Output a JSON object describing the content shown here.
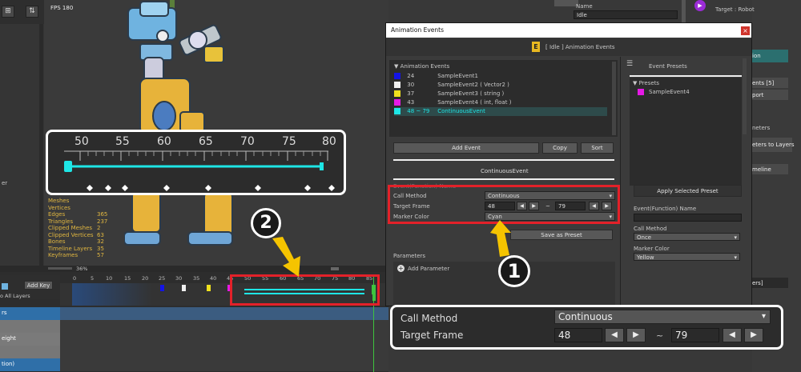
{
  "toolbar": {
    "fps": "FPS 180"
  },
  "inspector": {
    "name_label": "Name",
    "name_value": "Idle",
    "target_label": "Target : Robot"
  },
  "stats": [
    {
      "k": "Meshes",
      "v": ""
    },
    {
      "k": "Vertices",
      "v": ""
    },
    {
      "k": "Edges",
      "v": "365"
    },
    {
      "k": "Triangles",
      "v": "237"
    },
    {
      "k": "Clipped Meshes",
      "v": "2"
    },
    {
      "k": "Clipped Vertices",
      "v": "63"
    },
    {
      "k": "Bones",
      "v": "32"
    },
    {
      "k": "Timeline Layers",
      "v": "35"
    },
    {
      "k": "Keyframes",
      "v": "57"
    }
  ],
  "zoom_ruler": {
    "ticks": [
      "50",
      "55",
      "60",
      "65",
      "70",
      "75",
      "80"
    ]
  },
  "timeline": {
    "zoom_pct": "36%",
    "ruler": [
      "0",
      "5",
      "10",
      "15",
      "20",
      "25",
      "30",
      "35",
      "40",
      "45",
      "50",
      "55",
      "60",
      "65",
      "70",
      "75",
      "80",
      "85"
    ],
    "add_key": "Add Key",
    "all_layers": "o All Layers",
    "layer_labels": [
      "rs",
      "",
      "eight",
      "",
      "tion)"
    ]
  },
  "dialog": {
    "title": "Animation Events",
    "header": "[ Idle ] Animation Events",
    "events_header": "▼ Animation Events",
    "events": [
      {
        "frame": "24",
        "name": "SampleEvent1",
        "color": "#1414e6"
      },
      {
        "frame": "30",
        "name": "SampleEvent2  ( Vector2 )",
        "color": "#f0f0f0"
      },
      {
        "frame": "37",
        "name": "SampleEvent3  ( string )",
        "color": "#f0e11e"
      },
      {
        "frame": "43",
        "name": "SampleEvent4  ( int, float )",
        "color": "#e619e6"
      },
      {
        "frame": "48 ~ 79",
        "name": "ContinuousEvent",
        "color": "#1ee6e6"
      }
    ],
    "add_event": "Add Event",
    "copy": "Copy",
    "sort": "Sort",
    "selected_event": "ContinuousEvent",
    "hidden_row": "Event(Function) Name",
    "call_method_label": "Call Method",
    "call_method_value": "Continuous",
    "target_frame_label": "Target Frame",
    "frame_start": "48",
    "frame_end": "79",
    "tilde": "~",
    "marker_color_label": "Marker Color",
    "marker_color_value": "Cyan",
    "save_preset": "Save as Preset",
    "parameters": "Parameters",
    "add_parameter": "Add Parameter",
    "presets_title": "Event Presets",
    "presets_header": "▼ Presets",
    "preset_item": "SampleEvent4",
    "apply_preset": "Apply Selected Preset",
    "preset_fn_label": "Event(Function) Name",
    "preset_call_label": "Call Method",
    "preset_call_value": "Once",
    "preset_marker_label": "Marker Color",
    "preset_marker_value": "Yellow"
  },
  "right_panel": {
    "items": [
      "ion",
      "ents [5]",
      "port",
      "neters",
      "eters to Layers",
      "meline",
      "ers]"
    ]
  },
  "zoom_box": {
    "call_method_label": "Call Method",
    "call_method_value": "Continuous",
    "target_frame_label": "Target Frame",
    "frame_start": "48",
    "frame_end": "79",
    "tilde": "~"
  },
  "callouts": {
    "one": "1",
    "two": "2"
  },
  "colors": {
    "accent_cyan": "#1ee6e6",
    "highlight_red": "#e32129",
    "arrow_yellow": "#f5c400"
  }
}
